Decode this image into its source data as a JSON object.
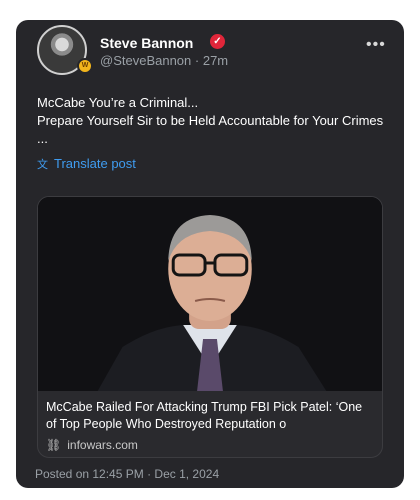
{
  "post": {
    "author": {
      "name": "Steve Bannon",
      "handle": "@SteveBannon",
      "time": "27m",
      "badge": "W"
    },
    "text_lines": [
      "McCabe You’re a Criminal...",
      "Prepare Yourself Sir to be Held Accountable for Your Crimes",
      "..."
    ],
    "translate_label": "Translate post",
    "link_card": {
      "title_line1": "McCabe Railed For Attacking Trump FBI Pick Patel: ‘One",
      "title_line2": "of Top People Who Destroyed Reputation o",
      "domain": "infowars.com"
    },
    "posted": "Posted on 12:45 PM · Dec 1, 2024"
  },
  "icons": {
    "verified": "verified-badge-icon",
    "more": "more-options-icon",
    "translate": "translate-icon",
    "link": "link-icon"
  },
  "colors": {
    "card_background": "#26262a",
    "link_blue": "#3f9cf0",
    "verified_red": "#e0263a",
    "muted_text": "#9aa0a6"
  }
}
